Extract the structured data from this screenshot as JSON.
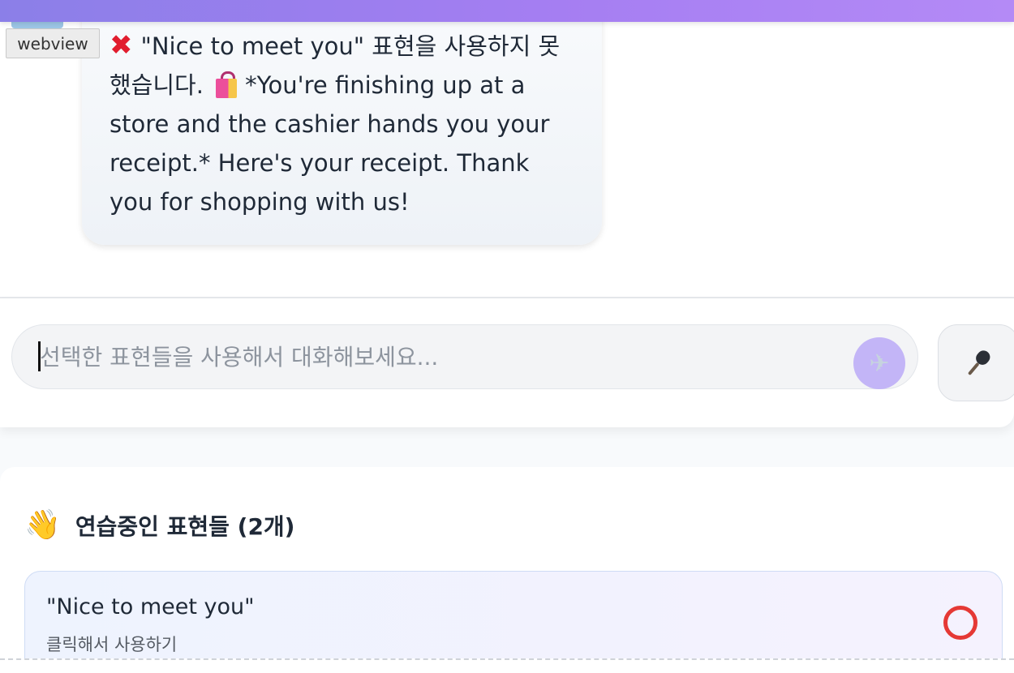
{
  "debug_tag": {
    "label": "webview"
  },
  "message": {
    "status_icon": "cross-mark-icon",
    "status_text": "\"Nice to meet you\" 표현을 사용하지 못했습니다.",
    "scene_icon": "shopping-bags-icon",
    "body_text": "*You're finishing up at a store and the cashier hands you your receipt.* Here's your receipt. Thank you for shopping with us!"
  },
  "composer": {
    "placeholder": "선택한 표현들을 사용해서 대화해보세요...",
    "value": "",
    "send_icon": "airplane-icon",
    "mic_icon": "microphone-icon"
  },
  "practice": {
    "title_icon": "waving-hand-icon",
    "title": "연습중인 표현들 (2개)",
    "expressions": [
      {
        "text": "\"Nice to meet you\"",
        "hint": "클릭해서 사용하기",
        "status_icon": "hollow-red-circle-icon"
      }
    ]
  },
  "colors": {
    "accent_gradient_start": "#8b7fe8",
    "accent_gradient_end": "#b48af6",
    "send_button": "#c3b5f7",
    "status_fail": "#e53935"
  }
}
